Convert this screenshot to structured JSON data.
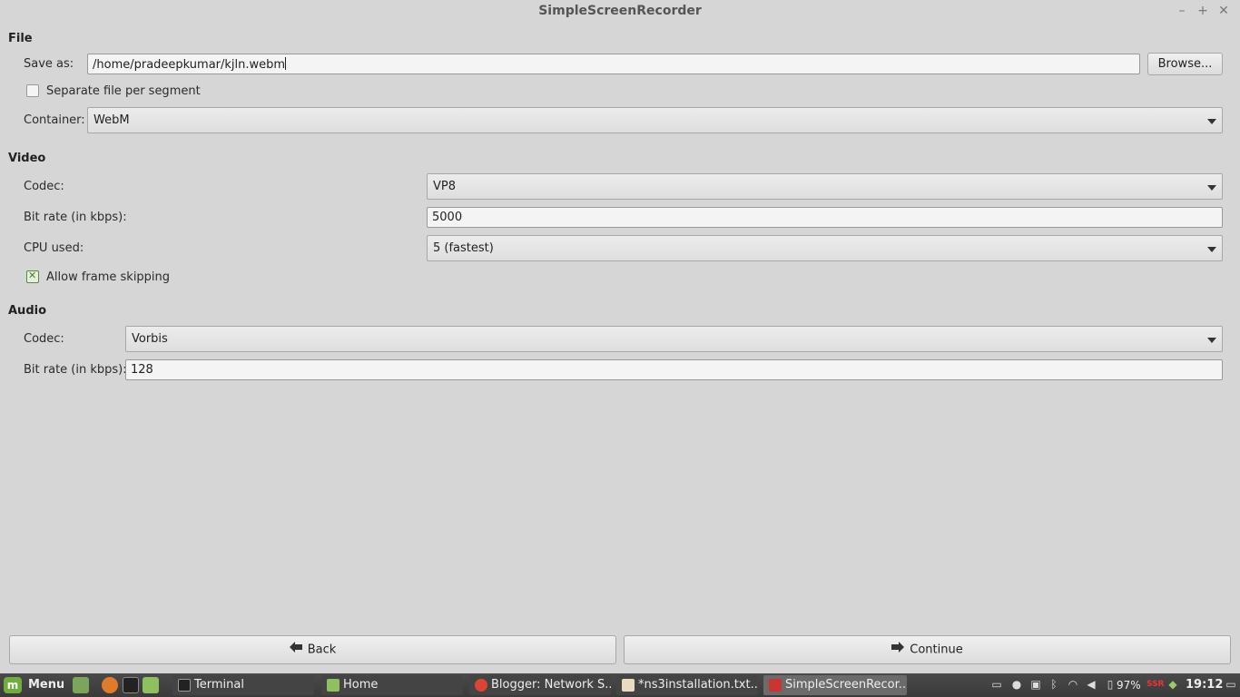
{
  "window": {
    "title": "SimpleScreenRecorder"
  },
  "file": {
    "heading": "File",
    "save_as_label": "Save as:",
    "save_as_value": "/home/pradeepkumar/kjln.webm",
    "browse_label": "Browse...",
    "separate_label": "Separate file per segment",
    "separate_checked": false,
    "container_label": "Container:",
    "container_value": "WebM"
  },
  "video": {
    "heading": "Video",
    "codec_label": "Codec:",
    "codec_value": "VP8",
    "bitrate_label": "Bit rate (in kbps):",
    "bitrate_value": "5000",
    "cpu_label": "CPU used:",
    "cpu_value": "5 (fastest)",
    "skip_label": "Allow frame skipping",
    "skip_checked": true
  },
  "audio": {
    "heading": "Audio",
    "codec_label": "Codec:",
    "codec_value": "Vorbis",
    "bitrate_label": "Bit rate (in kbps):",
    "bitrate_value": "128"
  },
  "footer": {
    "back_label": "Back",
    "continue_label": "Continue"
  },
  "taskbar": {
    "menu_label": "Menu",
    "tasks": [
      {
        "label": "Terminal"
      },
      {
        "label": "Home"
      },
      {
        "label": "Blogger: Network S..."
      },
      {
        "label": "*ns3installation.txt..."
      },
      {
        "label": "SimpleScreenRecor..."
      }
    ],
    "battery": "97%",
    "clock": "19:12"
  },
  "colors": {
    "accent_green": "#6fae3b",
    "taskbar": "#3e3e3e",
    "window_bg": "#d6d6d6"
  }
}
